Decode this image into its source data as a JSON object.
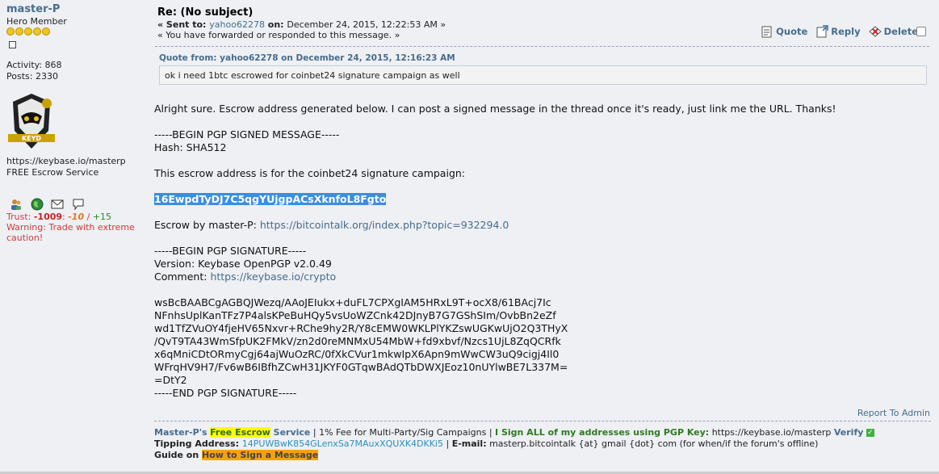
{
  "profile": {
    "username": "master-P",
    "rank": "Hero Member",
    "activity": "Activity: 868",
    "posts": "Posts: 2330",
    "website": "https://keybase.io/masterp",
    "tagline": "FREE Escrow Service",
    "trust_prefix": "Trust: ",
    "trust_neg": "-1009",
    "trust_sep1": ": ",
    "trust_ten": "-10",
    "trust_sep2": " / ",
    "trust_pos": "+15",
    "warning": "Warning: Trade with extreme caution!",
    "avatar_text": "KEYD"
  },
  "message": {
    "subject": "Re: (No subject)",
    "sent_label": "« Sent to: ",
    "sent_to": "yahoo62278",
    "on_label": " on: ",
    "date": "December 24, 2015, 12:22:53 AM",
    "sent_suffix": " »",
    "forwarded": "« You have forwarded or responded to this message. »",
    "actions": {
      "quote": "Quote",
      "reply": "Reply",
      "delete": "Delete"
    }
  },
  "quote": {
    "header": "Quote from: yahoo62278 on December 24, 2015, 12:16:23 AM",
    "text": "ok i need 1btc escrowed for coinbet24 signature campaign as well"
  },
  "body": {
    "line1": "Alright sure. Escrow address generated below. I can post a signed message in the thread once it's ready, just link me the URL. Thanks!",
    "pgp_begin": "-----BEGIN PGP SIGNED MESSAGE-----",
    "hash": "Hash: SHA512",
    "escrow_for": "This escrow address is for the coinbet24 signature campaign:",
    "address": "16EwpdTyDJ7C5qgYUjgpACsXknfoL8Fgto",
    "escrow_by": "Escrow by master-P: ",
    "escrow_link": "https://bitcointalk.org/index.php?topic=932294.0",
    "sig_begin": "-----BEGIN PGP SIGNATURE-----",
    "version": "Version: Keybase OpenPGP v2.0.49",
    "comment_label": "Comment: ",
    "comment_link": "https://keybase.io/crypto",
    "sig_lines": [
      "wsBcBAABCgAGBQJWezq/AAoJEIukx+duFL7CPXgIAM5HRxL9T+ocX8/61BAcj7Ic",
      "NFnhsUplKanTFz7P4alsKPeBuHQy5vsUoWZCnk42DJnyB7G7GShSIm/OvbBn2eZf",
      "wd1TfZVuOY4fjeHV65Nxvr+RChe9hy2R/Y8cEMW0WKLPlYKZswUGKwUjO2Q3THyX",
      "/QvT9TA43WmSfpUK2FMkV/zn2d0reMNMxU54MbW+fd9xbvf/Nzcs1UjL8ZqQCRfk",
      "x6qMniCDtORmyCgj64ajWuOzRC/0fXkCVur1mkwIpX6Apn9mWwCW3uQ9cigj4Il0",
      "WFrqHV9H7/Fv6wB6IBfhZCwH31JKYF0GTqwBAdQTbDWXJEoz10nUYlwBE7L337M=",
      "=DtY2"
    ],
    "sig_end": "-----END PGP SIGNATURE-----"
  },
  "report": "Report To Admin",
  "signature": {
    "name": "Master-P's",
    "free_escrow": "Free Escrow",
    "service": " Service",
    "fee": " | 1% Fee for Multi-Party/Sig Campaigns | ",
    "sign_all": "I Sign ALL of my addresses using PGP Key:",
    "keybase": " https://keybase.io/masterp ",
    "verify": "Verify",
    "tipping_label": "Tipping Address: ",
    "tipping_addr": "14PUWBwK854GLenxSa7MAuxXQUXK4DKKi5",
    "email_sep": " | ",
    "email_label": "E-mail:",
    "email": " masterp.bitcointalk {at} gmail {dot} com (for when/if the forum's offline)",
    "guide_label": "Guide on ",
    "guide_link": "How to Sign a Message"
  }
}
